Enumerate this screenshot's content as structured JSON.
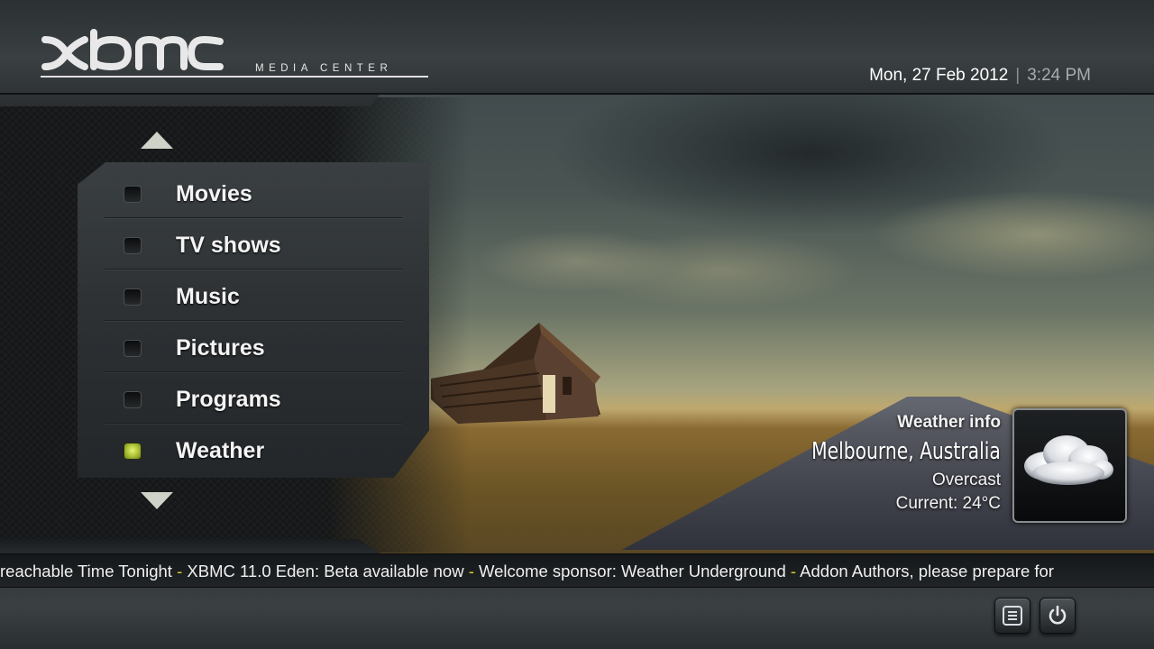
{
  "header": {
    "logo_text": "XBMC",
    "logo_subtitle": "MEDIA CENTER",
    "date": "Mon, 27 Feb 2012",
    "separator": "|",
    "time": "3:24 PM"
  },
  "menu": {
    "items": [
      {
        "label": "Movies",
        "active": false
      },
      {
        "label": "TV shows",
        "active": false
      },
      {
        "label": "Music",
        "active": false
      },
      {
        "label": "Pictures",
        "active": false
      },
      {
        "label": "Programs",
        "active": false
      },
      {
        "label": "Weather",
        "active": true
      }
    ],
    "scroll_up_icon": "triangle-up-icon",
    "scroll_down_icon": "triangle-down-icon"
  },
  "weather": {
    "title": "Weather info",
    "location": "Melbourne, Australia",
    "condition": "Overcast",
    "current": "Current: 24°C",
    "icon": "cloud-icon"
  },
  "ticker": {
    "items": [
      "reachable Time Tonight",
      "XBMC 11.0 Eden: Beta available now",
      "Welcome sponsor: Weather Underground",
      "Addon Authors, please prepare for"
    ],
    "separator": " - "
  },
  "system_buttons": {
    "favourites_icon": "list-icon",
    "power_icon": "power-icon"
  },
  "colors": {
    "accent_active": "#b3c93b",
    "ticker_separator": "#d7d330"
  }
}
